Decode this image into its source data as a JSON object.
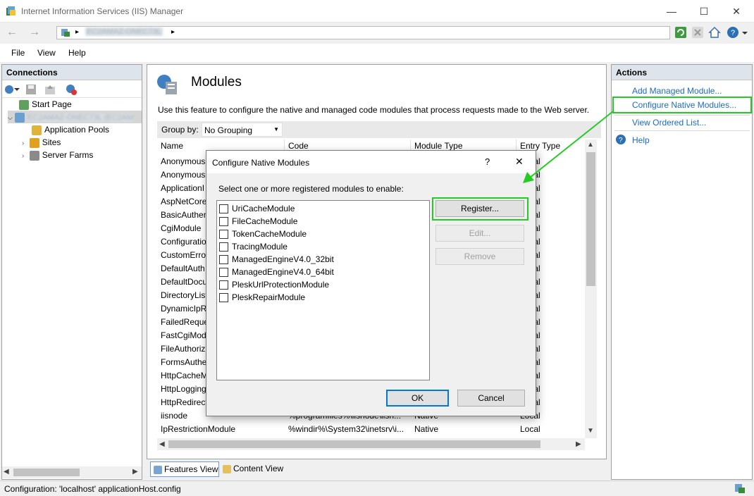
{
  "window": {
    "title": "Internet Information Services (IIS) Manager",
    "controls": {
      "minimize": "—",
      "maximize": "☐",
      "close": "✕"
    }
  },
  "address": {
    "server_blurred": "EC2AMAZ-ONEC73L",
    "separator": "▸",
    "separator2": "▸"
  },
  "menu": {
    "file": "File",
    "view": "View",
    "help": "Help"
  },
  "connections": {
    "title": "Connections",
    "tree": {
      "start_page": "Start Page",
      "server_blurred": "EC2AMAZ-ONEC73L (EC2AM",
      "app_pools": "Application Pools",
      "sites": "Sites",
      "server_farms": "Server Farms"
    }
  },
  "main": {
    "title": "Modules",
    "description": "Use this feature to configure the native and managed code modules that process requests made to the Web server.",
    "group_by_label": "Group by:",
    "group_by_value": "No Grouping",
    "columns": {
      "name": "Name",
      "code": "Code",
      "module_type": "Module Type",
      "entry_type": "Entry Type"
    },
    "rows": [
      {
        "name": "Anonymous"
      },
      {
        "name": "Anonymous"
      },
      {
        "name": "ApplicationI"
      },
      {
        "name": "AspNetCore"
      },
      {
        "name": "BasicAuthen"
      },
      {
        "name": "CgiModule"
      },
      {
        "name": "Configuratio"
      },
      {
        "name": "CustomErro"
      },
      {
        "name": "DefaultAuth"
      },
      {
        "name": "DefaultDocu"
      },
      {
        "name": "DirectoryList"
      },
      {
        "name": "DynamicIpR"
      },
      {
        "name": "FailedReque"
      },
      {
        "name": "FastCgiMod"
      },
      {
        "name": "FileAuthoriz"
      },
      {
        "name": "FormsAuthe"
      },
      {
        "name": "HttpCacheM"
      },
      {
        "name": "HttpLogging"
      },
      {
        "name": "HttpRedirect"
      },
      {
        "name": "iisnode",
        "code": "%programfiles%\\iisnode\\iisn...",
        "module_type": "Native",
        "entry_type": "Local"
      },
      {
        "name": "IpRestrictionModule",
        "code": "%windir%\\System32\\inetsrv\\i...",
        "module_type": "Native",
        "entry_type": "Local"
      }
    ],
    "entry_cell": "Local",
    "view_tabs": {
      "features": "Features View",
      "content": "Content View"
    }
  },
  "actions": {
    "title": "Actions",
    "add_managed": "Add Managed Module...",
    "configure_native": "Configure Native Modules...",
    "view_ordered": "View Ordered List...",
    "help": "Help"
  },
  "dialog": {
    "title": "Configure Native Modules",
    "help_glyph": "?",
    "close_glyph": "✕",
    "prompt": "Select one or more registered modules to enable:",
    "modules": [
      "UriCacheModule",
      "FileCacheModule",
      "TokenCacheModule",
      "TracingModule",
      "ManagedEngineV4.0_32bit",
      "ManagedEngineV4.0_64bit",
      "PleskUrlProtectionModule",
      "PleskRepairModule"
    ],
    "register": "Register...",
    "edit": "Edit...",
    "remove": "Remove",
    "ok": "OK",
    "cancel": "Cancel"
  },
  "status": {
    "text": "Configuration: 'localhost' applicationHost.config"
  },
  "colors": {
    "highlight": "#22cc22",
    "link": "#1b6ac9",
    "panel_head": "#dde4ec"
  }
}
